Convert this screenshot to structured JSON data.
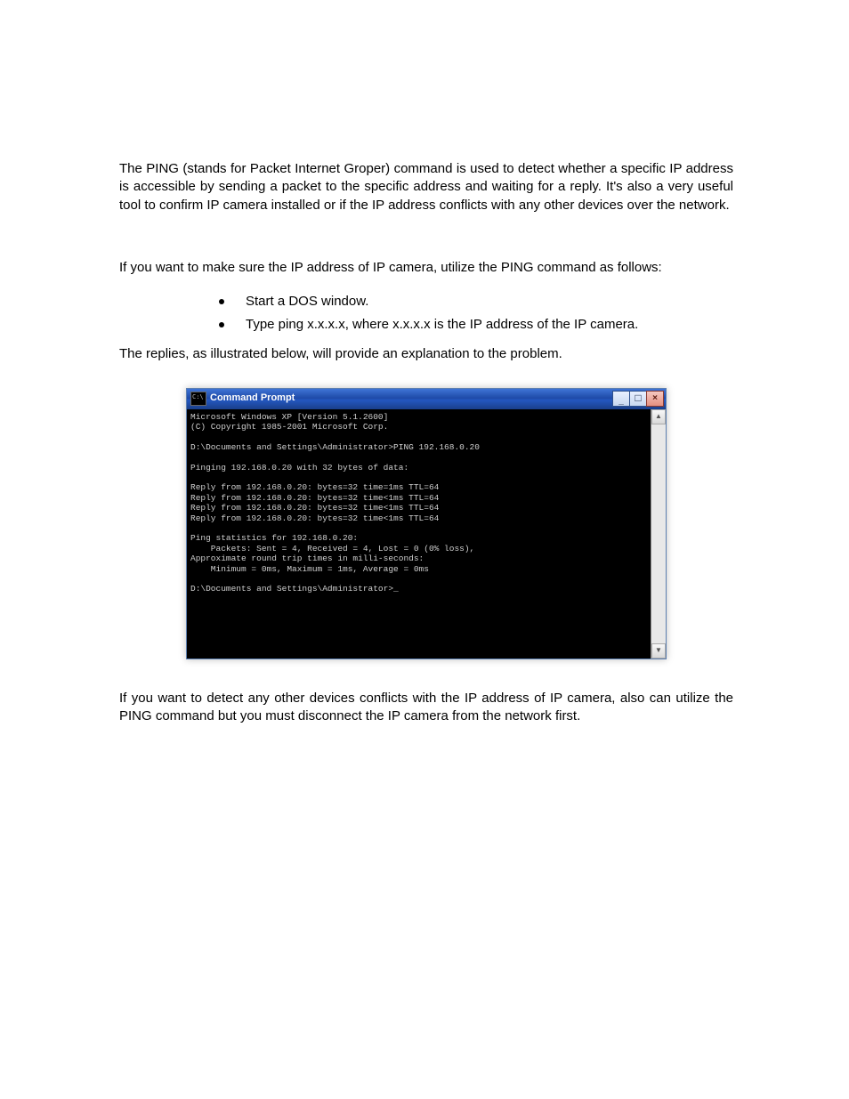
{
  "doc": {
    "p1": "The PING (stands for Packet Internet Groper) command is used to detect whether a specific IP address is accessible by sending a packet to the specific address and waiting for a reply. It's also a very useful tool to confirm IP camera installed or if the IP address conflicts with any other devices over the network.",
    "p2": "If you want to make sure the IP address of IP camera, utilize the PING command as follows:",
    "bullets": [
      "Start a DOS window.",
      "Type ping x.x.x.x, where x.x.x.x is the IP address of the IP camera."
    ],
    "p3": "The replies, as illustrated below, will provide an explanation to the problem.",
    "p4": "If you want to detect any other devices conflicts with the IP address of IP camera, also can utilize the PING command but you must disconnect the IP camera from the network first."
  },
  "cmd": {
    "title": "Command Prompt",
    "lines": [
      "Microsoft Windows XP [Version 5.1.2600]",
      "(C) Copyright 1985-2001 Microsoft Corp.",
      "",
      "D:\\Documents and Settings\\Administrator>PING 192.168.0.20",
      "",
      "Pinging 192.168.0.20 with 32 bytes of data:",
      "",
      "Reply from 192.168.0.20: bytes=32 time=1ms TTL=64",
      "Reply from 192.168.0.20: bytes=32 time<1ms TTL=64",
      "Reply from 192.168.0.20: bytes=32 time<1ms TTL=64",
      "Reply from 192.168.0.20: bytes=32 time<1ms TTL=64",
      "",
      "Ping statistics for 192.168.0.20:",
      "    Packets: Sent = 4, Received = 4, Lost = 0 (0% loss),",
      "Approximate round trip times in milli-seconds:",
      "    Minimum = 0ms, Maximum = 1ms, Average = 0ms",
      "",
      "D:\\Documents and Settings\\Administrator>_"
    ]
  },
  "labels": {
    "minimize": "_",
    "maximize": "□",
    "close": "×",
    "scroll_up": "▲",
    "scroll_down": "▼"
  }
}
